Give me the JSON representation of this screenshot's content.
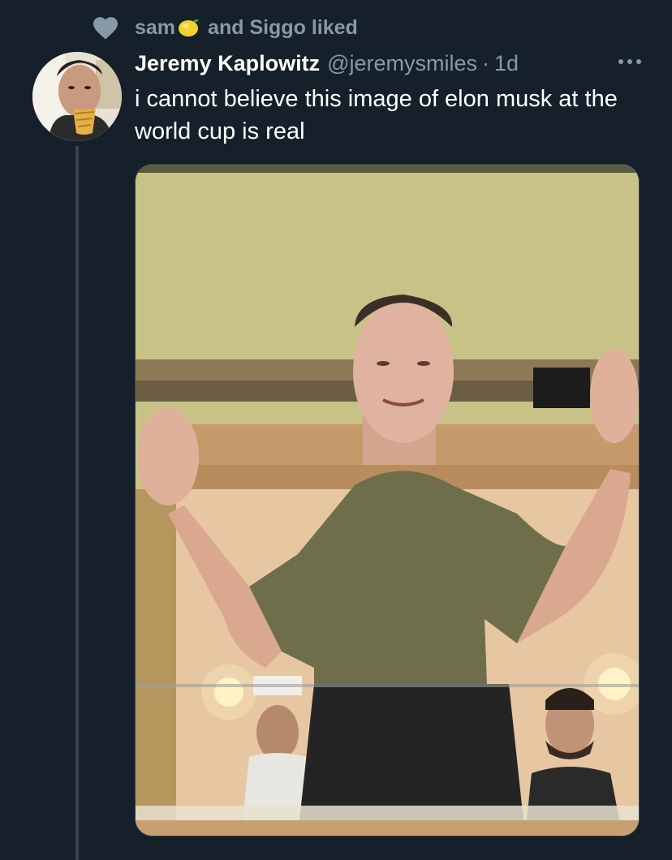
{
  "social_context": {
    "icon": "heart-icon",
    "user1": "sam",
    "user1_emoji": "lemon-emoji",
    "rest": "and Siggo liked"
  },
  "tweet": {
    "author_name": "Jeremy Kaplowitz",
    "author_handle": "@jeremysmiles",
    "separator": "·",
    "time": "1d",
    "more_icon": "more-options-icon",
    "text": "i cannot believe this image of elon musk at the world cup is real",
    "media_alt": "photo"
  },
  "colors": {
    "background": "#15202b",
    "secondary_text": "#8899a6",
    "thread_line": "#38444d"
  }
}
